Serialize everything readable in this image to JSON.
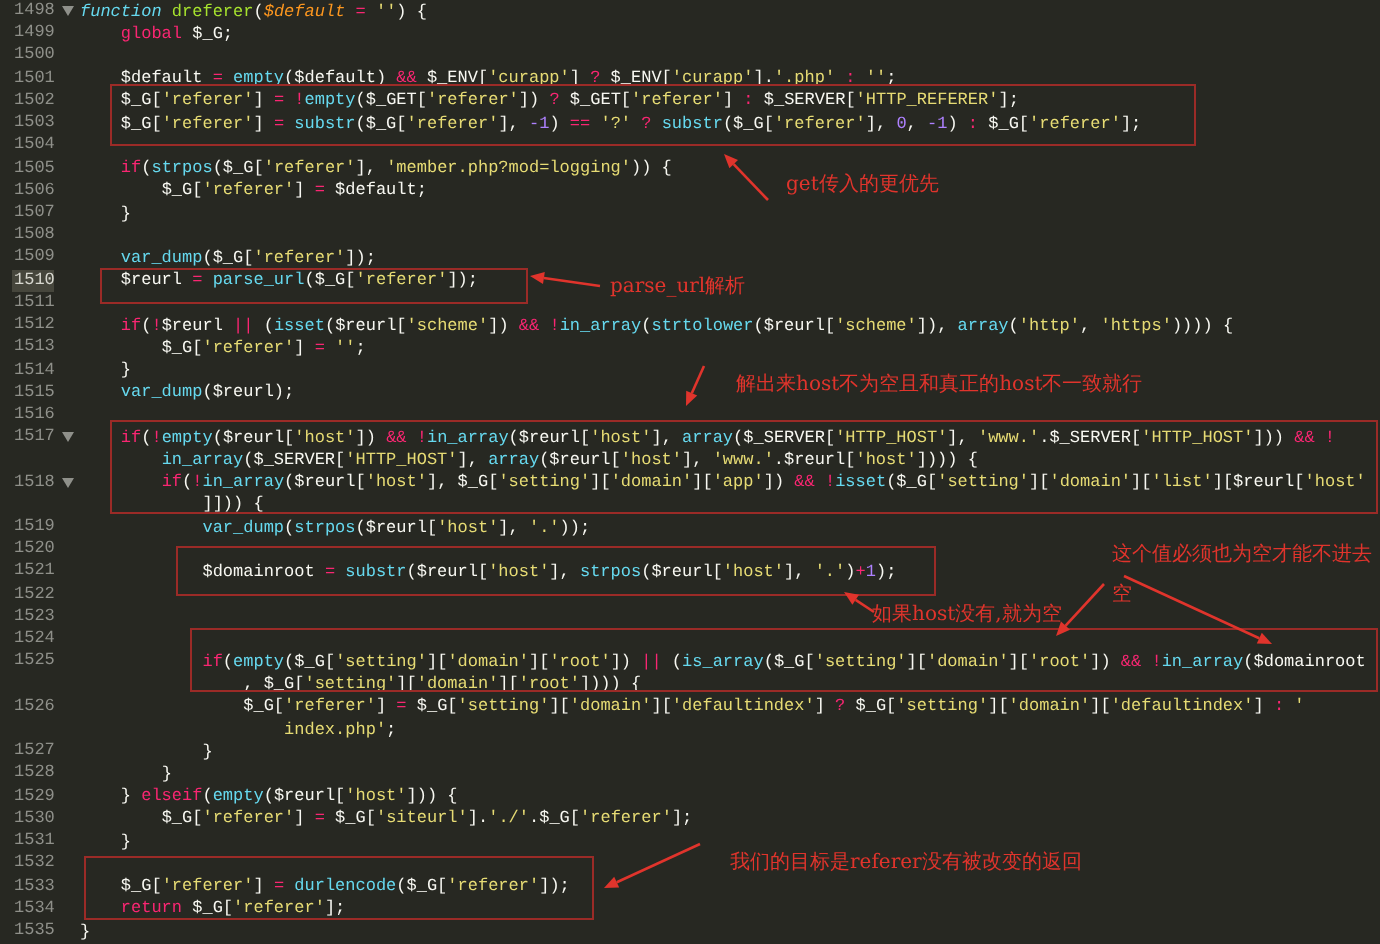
{
  "lines": [
    {
      "number": "1498",
      "fold": true,
      "current": false,
      "rows": [
        {
          "tokens": [
            {
              "kind": "storage",
              "text": "function "
            },
            {
              "kind": "name",
              "text": "dreferer"
            },
            {
              "kind": "plain",
              "text": "("
            },
            {
              "kind": "param",
              "text": "$default "
            },
            {
              "kind": "kw",
              "text": "= "
            },
            {
              "kind": "str",
              "text": "''"
            },
            {
              "kind": "plain",
              "text": ") {"
            }
          ]
        }
      ]
    },
    {
      "number": "1499",
      "fold": false,
      "current": false,
      "rows": [
        {
          "tokens": [
            {
              "kind": "kw",
              "text": "    global"
            },
            {
              "kind": "plain",
              "text": " $_G;"
            }
          ]
        }
      ]
    },
    {
      "number": "1500",
      "fold": false,
      "current": false,
      "rows": [
        {
          "tokens": []
        }
      ]
    },
    {
      "number": "1501",
      "fold": false,
      "current": false,
      "rows": [
        {
          "tokens": [
            {
              "kind": "plain",
              "text": "    $default "
            },
            {
              "kind": "kw",
              "text": "= "
            },
            {
              "kind": "fn",
              "text": "empty"
            },
            {
              "kind": "plain",
              "text": "($default) "
            },
            {
              "kind": "kw",
              "text": "&&"
            },
            {
              "kind": "plain",
              "text": " $_ENV["
            },
            {
              "kind": "str",
              "text": "'curapp'"
            },
            {
              "kind": "plain",
              "text": "] "
            },
            {
              "kind": "kw",
              "text": "?"
            },
            {
              "kind": "plain",
              "text": " $_ENV["
            },
            {
              "kind": "str",
              "text": "'curapp'"
            },
            {
              "kind": "plain",
              "text": "]."
            },
            {
              "kind": "str",
              "text": "'.php' "
            },
            {
              "kind": "kw",
              "text": ": "
            },
            {
              "kind": "str",
              "text": "''"
            },
            {
              "kind": "plain",
              "text": ";"
            }
          ]
        }
      ]
    },
    {
      "number": "1502",
      "fold": false,
      "current": false,
      "rows": [
        {
          "tokens": [
            {
              "kind": "plain",
              "text": "    $_G["
            },
            {
              "kind": "str",
              "text": "'referer'"
            },
            {
              "kind": "plain",
              "text": "] "
            },
            {
              "kind": "kw",
              "text": "= !"
            },
            {
              "kind": "fn",
              "text": "empty"
            },
            {
              "kind": "plain",
              "text": "($_GET["
            },
            {
              "kind": "str",
              "text": "'referer'"
            },
            {
              "kind": "plain",
              "text": "]) "
            },
            {
              "kind": "kw",
              "text": "?"
            },
            {
              "kind": "plain",
              "text": " $_GET["
            },
            {
              "kind": "str",
              "text": "'referer'"
            },
            {
              "kind": "plain",
              "text": "] "
            },
            {
              "kind": "kw",
              "text": ":"
            },
            {
              "kind": "plain",
              "text": " $_SERVER["
            },
            {
              "kind": "str",
              "text": "'HTTP_REFERER'"
            },
            {
              "kind": "plain",
              "text": "];"
            }
          ]
        }
      ]
    },
    {
      "number": "1503",
      "fold": false,
      "current": false,
      "rows": [
        {
          "tokens": [
            {
              "kind": "plain",
              "text": "    $_G["
            },
            {
              "kind": "str",
              "text": "'referer'"
            },
            {
              "kind": "plain",
              "text": "] "
            },
            {
              "kind": "kw",
              "text": "= "
            },
            {
              "kind": "fn",
              "text": "substr"
            },
            {
              "kind": "plain",
              "text": "($_G["
            },
            {
              "kind": "str",
              "text": "'referer'"
            },
            {
              "kind": "plain",
              "text": "], "
            },
            {
              "kind": "num",
              "text": "-1"
            },
            {
              "kind": "plain",
              "text": ") "
            },
            {
              "kind": "kw",
              "text": "== "
            },
            {
              "kind": "str",
              "text": "'?' "
            },
            {
              "kind": "kw",
              "text": "? "
            },
            {
              "kind": "fn",
              "text": "substr"
            },
            {
              "kind": "plain",
              "text": "($_G["
            },
            {
              "kind": "str",
              "text": "'referer'"
            },
            {
              "kind": "plain",
              "text": "], "
            },
            {
              "kind": "num",
              "text": "0"
            },
            {
              "kind": "plain",
              "text": ", "
            },
            {
              "kind": "num",
              "text": "-1"
            },
            {
              "kind": "plain",
              "text": ") "
            },
            {
              "kind": "kw",
              "text": ":"
            },
            {
              "kind": "plain",
              "text": " $_G["
            },
            {
              "kind": "str",
              "text": "'referer'"
            },
            {
              "kind": "plain",
              "text": "];"
            }
          ]
        }
      ]
    },
    {
      "number": "1504",
      "fold": false,
      "current": false,
      "rows": [
        {
          "tokens": []
        }
      ]
    },
    {
      "number": "1505",
      "fold": false,
      "current": false,
      "rows": [
        {
          "tokens": [
            {
              "kind": "kw",
              "text": "    if"
            },
            {
              "kind": "plain",
              "text": "("
            },
            {
              "kind": "fn",
              "text": "strpos"
            },
            {
              "kind": "plain",
              "text": "($_G["
            },
            {
              "kind": "str",
              "text": "'referer'"
            },
            {
              "kind": "plain",
              "text": "], "
            },
            {
              "kind": "str",
              "text": "'member.php?mod=logging'"
            },
            {
              "kind": "plain",
              "text": ")) {"
            }
          ]
        }
      ]
    },
    {
      "number": "1506",
      "fold": false,
      "current": false,
      "rows": [
        {
          "tokens": [
            {
              "kind": "plain",
              "text": "        $_G["
            },
            {
              "kind": "str",
              "text": "'referer'"
            },
            {
              "kind": "plain",
              "text": "] "
            },
            {
              "kind": "kw",
              "text": "="
            },
            {
              "kind": "plain",
              "text": " $default;"
            }
          ]
        }
      ]
    },
    {
      "number": "1507",
      "fold": false,
      "current": false,
      "rows": [
        {
          "tokens": [
            {
              "kind": "plain",
              "text": "    }"
            }
          ]
        }
      ]
    },
    {
      "number": "1508",
      "fold": false,
      "current": false,
      "rows": [
        {
          "tokens": []
        }
      ]
    },
    {
      "number": "1509",
      "fold": false,
      "current": false,
      "rows": [
        {
          "tokens": [
            {
              "kind": "fn",
              "text": "    var_dump"
            },
            {
              "kind": "plain",
              "text": "($_G["
            },
            {
              "kind": "str",
              "text": "'referer'"
            },
            {
              "kind": "plain",
              "text": "]);"
            }
          ]
        }
      ]
    },
    {
      "number": "1510",
      "fold": false,
      "current": true,
      "rows": [
        {
          "tokens": [
            {
              "kind": "plain",
              "text": "    $reurl "
            },
            {
              "kind": "kw",
              "text": "= "
            },
            {
              "kind": "fn",
              "text": "parse_url"
            },
            {
              "kind": "plain",
              "text": "($_G["
            },
            {
              "kind": "str",
              "text": "'referer'"
            },
            {
              "kind": "plain",
              "text": "]);"
            }
          ]
        }
      ]
    },
    {
      "number": "1511",
      "fold": false,
      "current": false,
      "rows": [
        {
          "tokens": []
        }
      ]
    },
    {
      "number": "1512",
      "fold": false,
      "current": false,
      "rows": [
        {
          "tokens": [
            {
              "kind": "kw",
              "text": "    if"
            },
            {
              "kind": "plain",
              "text": "("
            },
            {
              "kind": "kw",
              "text": "!"
            },
            {
              "kind": "plain",
              "text": "$reurl "
            },
            {
              "kind": "kw",
              "text": "||"
            },
            {
              "kind": "plain",
              "text": " ("
            },
            {
              "kind": "fn",
              "text": "isset"
            },
            {
              "kind": "plain",
              "text": "($reurl["
            },
            {
              "kind": "str",
              "text": "'scheme'"
            },
            {
              "kind": "plain",
              "text": "]) "
            },
            {
              "kind": "kw",
              "text": "&& !"
            },
            {
              "kind": "fn",
              "text": "in_array"
            },
            {
              "kind": "plain",
              "text": "("
            },
            {
              "kind": "fn",
              "text": "strtolower"
            },
            {
              "kind": "plain",
              "text": "($reurl["
            },
            {
              "kind": "str",
              "text": "'scheme'"
            },
            {
              "kind": "plain",
              "text": "]), "
            },
            {
              "kind": "fn",
              "text": "array"
            },
            {
              "kind": "plain",
              "text": "("
            },
            {
              "kind": "str",
              "text": "'http'"
            },
            {
              "kind": "plain",
              "text": ", "
            },
            {
              "kind": "str",
              "text": "'https'"
            },
            {
              "kind": "plain",
              "text": ")))) {"
            }
          ]
        }
      ]
    },
    {
      "number": "1513",
      "fold": false,
      "current": false,
      "rows": [
        {
          "tokens": [
            {
              "kind": "plain",
              "text": "        $_G["
            },
            {
              "kind": "str",
              "text": "'referer'"
            },
            {
              "kind": "plain",
              "text": "] "
            },
            {
              "kind": "kw",
              "text": "= "
            },
            {
              "kind": "str",
              "text": "''"
            },
            {
              "kind": "plain",
              "text": ";"
            }
          ]
        }
      ]
    },
    {
      "number": "1514",
      "fold": false,
      "current": false,
      "rows": [
        {
          "tokens": [
            {
              "kind": "plain",
              "text": "    }"
            }
          ]
        }
      ]
    },
    {
      "number": "1515",
      "fold": false,
      "current": false,
      "rows": [
        {
          "tokens": [
            {
              "kind": "fn",
              "text": "    var_dump"
            },
            {
              "kind": "plain",
              "text": "($reurl);"
            }
          ]
        }
      ]
    },
    {
      "number": "1516",
      "fold": false,
      "current": false,
      "rows": [
        {
          "tokens": []
        }
      ]
    },
    {
      "number": "1517",
      "fold": true,
      "current": false,
      "rows": [
        {
          "tokens": [
            {
              "kind": "kw",
              "text": "    if"
            },
            {
              "kind": "plain",
              "text": "("
            },
            {
              "kind": "kw",
              "text": "!"
            },
            {
              "kind": "fn",
              "text": "empty"
            },
            {
              "kind": "plain",
              "text": "($reurl["
            },
            {
              "kind": "str",
              "text": "'host'"
            },
            {
              "kind": "plain",
              "text": "]) "
            },
            {
              "kind": "kw",
              "text": "&& !"
            },
            {
              "kind": "fn",
              "text": "in_array"
            },
            {
              "kind": "plain",
              "text": "($reurl["
            },
            {
              "kind": "str",
              "text": "'host'"
            },
            {
              "kind": "plain",
              "text": "], "
            },
            {
              "kind": "fn",
              "text": "array"
            },
            {
              "kind": "plain",
              "text": "($_SERVER["
            },
            {
              "kind": "str",
              "text": "'HTTP_HOST'"
            },
            {
              "kind": "plain",
              "text": "], "
            },
            {
              "kind": "str",
              "text": "'www.'"
            },
            {
              "kind": "plain",
              "text": ".$_SERVER["
            },
            {
              "kind": "str",
              "text": "'HTTP_HOST'"
            },
            {
              "kind": "plain",
              "text": "])) "
            },
            {
              "kind": "kw",
              "text": "&& !"
            }
          ]
        },
        {
          "tokens": [
            {
              "kind": "fn",
              "text": "        in_array"
            },
            {
              "kind": "plain",
              "text": "($_SERVER["
            },
            {
              "kind": "str",
              "text": "'HTTP_HOST'"
            },
            {
              "kind": "plain",
              "text": "], "
            },
            {
              "kind": "fn",
              "text": "array"
            },
            {
              "kind": "plain",
              "text": "($reurl["
            },
            {
              "kind": "str",
              "text": "'host'"
            },
            {
              "kind": "plain",
              "text": "], "
            },
            {
              "kind": "str",
              "text": "'www.'"
            },
            {
              "kind": "plain",
              "text": ".$reurl["
            },
            {
              "kind": "str",
              "text": "'host'"
            },
            {
              "kind": "plain",
              "text": "]))) {"
            }
          ]
        }
      ]
    },
    {
      "number": "1518",
      "fold": true,
      "current": false,
      "rows": [
        {
          "tokens": [
            {
              "kind": "kw",
              "text": "        if"
            },
            {
              "kind": "plain",
              "text": "("
            },
            {
              "kind": "kw",
              "text": "!"
            },
            {
              "kind": "fn",
              "text": "in_array"
            },
            {
              "kind": "plain",
              "text": "($reurl["
            },
            {
              "kind": "str",
              "text": "'host'"
            },
            {
              "kind": "plain",
              "text": "], $_G["
            },
            {
              "kind": "str",
              "text": "'setting'"
            },
            {
              "kind": "plain",
              "text": "]["
            },
            {
              "kind": "str",
              "text": "'domain'"
            },
            {
              "kind": "plain",
              "text": "]["
            },
            {
              "kind": "str",
              "text": "'app'"
            },
            {
              "kind": "plain",
              "text": "]) "
            },
            {
              "kind": "kw",
              "text": "&& !"
            },
            {
              "kind": "fn",
              "text": "isset"
            },
            {
              "kind": "plain",
              "text": "($_G["
            },
            {
              "kind": "str",
              "text": "'setting'"
            },
            {
              "kind": "plain",
              "text": "]["
            },
            {
              "kind": "str",
              "text": "'domain'"
            },
            {
              "kind": "plain",
              "text": "]["
            },
            {
              "kind": "str",
              "text": "'list'"
            },
            {
              "kind": "plain",
              "text": "][$reurl["
            },
            {
              "kind": "str",
              "text": "'host'"
            }
          ]
        },
        {
          "tokens": [
            {
              "kind": "plain",
              "text": "            ]])) {"
            }
          ]
        }
      ]
    },
    {
      "number": "1519",
      "fold": false,
      "current": false,
      "rows": [
        {
          "tokens": [
            {
              "kind": "fn",
              "text": "            var_dump"
            },
            {
              "kind": "plain",
              "text": "("
            },
            {
              "kind": "fn",
              "text": "strpos"
            },
            {
              "kind": "plain",
              "text": "($reurl["
            },
            {
              "kind": "str",
              "text": "'host'"
            },
            {
              "kind": "plain",
              "text": "], "
            },
            {
              "kind": "str",
              "text": "'.'"
            },
            {
              "kind": "plain",
              "text": "));"
            }
          ]
        }
      ]
    },
    {
      "number": "1520",
      "fold": false,
      "current": false,
      "rows": [
        {
          "tokens": []
        }
      ]
    },
    {
      "number": "1521",
      "fold": false,
      "current": false,
      "rows": [
        {
          "tokens": [
            {
              "kind": "plain",
              "text": "            $domainroot "
            },
            {
              "kind": "kw",
              "text": "= "
            },
            {
              "kind": "fn",
              "text": "substr"
            },
            {
              "kind": "plain",
              "text": "($reurl["
            },
            {
              "kind": "str",
              "text": "'host'"
            },
            {
              "kind": "plain",
              "text": "], "
            },
            {
              "kind": "fn",
              "text": "strpos"
            },
            {
              "kind": "plain",
              "text": "($reurl["
            },
            {
              "kind": "str",
              "text": "'host'"
            },
            {
              "kind": "plain",
              "text": "], "
            },
            {
              "kind": "str",
              "text": "'.'"
            },
            {
              "kind": "plain",
              "text": ")"
            },
            {
              "kind": "kw",
              "text": "+"
            },
            {
              "kind": "num",
              "text": "1"
            },
            {
              "kind": "plain",
              "text": ");"
            }
          ]
        }
      ]
    },
    {
      "number": "1522",
      "fold": false,
      "current": false,
      "rows": [
        {
          "tokens": []
        }
      ]
    },
    {
      "number": "1523",
      "fold": false,
      "current": false,
      "rows": [
        {
          "tokens": []
        }
      ]
    },
    {
      "number": "1524",
      "fold": false,
      "current": false,
      "rows": [
        {
          "tokens": []
        }
      ]
    },
    {
      "number": "1525",
      "fold": false,
      "current": false,
      "rows": [
        {
          "tokens": [
            {
              "kind": "kw",
              "text": "            if"
            },
            {
              "kind": "plain",
              "text": "("
            },
            {
              "kind": "fn",
              "text": "empty"
            },
            {
              "kind": "plain",
              "text": "($_G["
            },
            {
              "kind": "str",
              "text": "'setting'"
            },
            {
              "kind": "plain",
              "text": "]["
            },
            {
              "kind": "str",
              "text": "'domain'"
            },
            {
              "kind": "plain",
              "text": "]["
            },
            {
              "kind": "str",
              "text": "'root'"
            },
            {
              "kind": "plain",
              "text": "]) "
            },
            {
              "kind": "kw",
              "text": "||"
            },
            {
              "kind": "plain",
              "text": " ("
            },
            {
              "kind": "fn",
              "text": "is_array"
            },
            {
              "kind": "plain",
              "text": "($_G["
            },
            {
              "kind": "str",
              "text": "'setting'"
            },
            {
              "kind": "plain",
              "text": "]["
            },
            {
              "kind": "str",
              "text": "'domain'"
            },
            {
              "kind": "plain",
              "text": "]["
            },
            {
              "kind": "str",
              "text": "'root'"
            },
            {
              "kind": "plain",
              "text": "]) "
            },
            {
              "kind": "kw",
              "text": "&& !"
            },
            {
              "kind": "fn",
              "text": "in_array"
            },
            {
              "kind": "plain",
              "text": "($domainroot"
            }
          ]
        },
        {
          "tokens": [
            {
              "kind": "plain",
              "text": "                , $_G["
            },
            {
              "kind": "str",
              "text": "'setting'"
            },
            {
              "kind": "plain",
              "text": "]["
            },
            {
              "kind": "str",
              "text": "'domain'"
            },
            {
              "kind": "plain",
              "text": "]["
            },
            {
              "kind": "str",
              "text": "'root'"
            },
            {
              "kind": "plain",
              "text": "]))) {"
            }
          ]
        }
      ]
    },
    {
      "number": "1526",
      "fold": false,
      "current": false,
      "rows": [
        {
          "tokens": [
            {
              "kind": "plain",
              "text": "                $_G["
            },
            {
              "kind": "str",
              "text": "'referer'"
            },
            {
              "kind": "plain",
              "text": "] "
            },
            {
              "kind": "kw",
              "text": "="
            },
            {
              "kind": "plain",
              "text": " $_G["
            },
            {
              "kind": "str",
              "text": "'setting'"
            },
            {
              "kind": "plain",
              "text": "]["
            },
            {
              "kind": "str",
              "text": "'domain'"
            },
            {
              "kind": "plain",
              "text": "]["
            },
            {
              "kind": "str",
              "text": "'defaultindex'"
            },
            {
              "kind": "plain",
              "text": "] "
            },
            {
              "kind": "kw",
              "text": "?"
            },
            {
              "kind": "plain",
              "text": " $_G["
            },
            {
              "kind": "str",
              "text": "'setting'"
            },
            {
              "kind": "plain",
              "text": "]["
            },
            {
              "kind": "str",
              "text": "'domain'"
            },
            {
              "kind": "plain",
              "text": "]["
            },
            {
              "kind": "str",
              "text": "'defaultindex'"
            },
            {
              "kind": "plain",
              "text": "] "
            },
            {
              "kind": "kw",
              "text": ": "
            },
            {
              "kind": "str",
              "text": "'"
            }
          ]
        },
        {
          "tokens": [
            {
              "kind": "str",
              "text": "                    index.php'"
            },
            {
              "kind": "plain",
              "text": ";"
            }
          ]
        }
      ]
    },
    {
      "number": "1527",
      "fold": false,
      "current": false,
      "rows": [
        {
          "tokens": [
            {
              "kind": "plain",
              "text": "            }"
            }
          ]
        }
      ]
    },
    {
      "number": "1528",
      "fold": false,
      "current": false,
      "rows": [
        {
          "tokens": [
            {
              "kind": "plain",
              "text": "        }"
            }
          ]
        }
      ]
    },
    {
      "number": "1529",
      "fold": false,
      "current": false,
      "rows": [
        {
          "tokens": [
            {
              "kind": "plain",
              "text": "    } "
            },
            {
              "kind": "kw",
              "text": "elseif"
            },
            {
              "kind": "plain",
              "text": "("
            },
            {
              "kind": "fn",
              "text": "empty"
            },
            {
              "kind": "plain",
              "text": "($reurl["
            },
            {
              "kind": "str",
              "text": "'host'"
            },
            {
              "kind": "plain",
              "text": "])) {"
            }
          ]
        }
      ]
    },
    {
      "number": "1530",
      "fold": false,
      "current": false,
      "rows": [
        {
          "tokens": [
            {
              "kind": "plain",
              "text": "        $_G["
            },
            {
              "kind": "str",
              "text": "'referer'"
            },
            {
              "kind": "plain",
              "text": "] "
            },
            {
              "kind": "kw",
              "text": "="
            },
            {
              "kind": "plain",
              "text": " $_G["
            },
            {
              "kind": "str",
              "text": "'siteurl'"
            },
            {
              "kind": "plain",
              "text": "]."
            },
            {
              "kind": "str",
              "text": "'./'"
            },
            {
              "kind": "plain",
              "text": ".$_G["
            },
            {
              "kind": "str",
              "text": "'referer'"
            },
            {
              "kind": "plain",
              "text": "];"
            }
          ]
        }
      ]
    },
    {
      "number": "1531",
      "fold": false,
      "current": false,
      "rows": [
        {
          "tokens": [
            {
              "kind": "plain",
              "text": "    }"
            }
          ]
        }
      ]
    },
    {
      "number": "1532",
      "fold": false,
      "current": false,
      "rows": [
        {
          "tokens": []
        }
      ]
    },
    {
      "number": "1533",
      "fold": false,
      "current": false,
      "rows": [
        {
          "tokens": [
            {
              "kind": "plain",
              "text": "    $_G["
            },
            {
              "kind": "str",
              "text": "'referer'"
            },
            {
              "kind": "plain",
              "text": "] "
            },
            {
              "kind": "kw",
              "text": "= "
            },
            {
              "kind": "fn",
              "text": "durlencode"
            },
            {
              "kind": "plain",
              "text": "($_G["
            },
            {
              "kind": "str",
              "text": "'referer'"
            },
            {
              "kind": "plain",
              "text": "]);"
            }
          ]
        }
      ]
    },
    {
      "number": "1534",
      "fold": false,
      "current": false,
      "rows": [
        {
          "tokens": [
            {
              "kind": "kw",
              "text": "    return"
            },
            {
              "kind": "plain",
              "text": " $_G["
            },
            {
              "kind": "str",
              "text": "'referer'"
            },
            {
              "kind": "plain",
              "text": "];"
            }
          ]
        }
      ]
    },
    {
      "number": "1535",
      "fold": false,
      "current": false,
      "rows": [
        {
          "tokens": [
            {
              "kind": "plain",
              "text": "}"
            }
          ]
        }
      ]
    }
  ],
  "annotations": [
    {
      "text": "get传入的更优先"
    },
    {
      "text": "parse_url解析"
    },
    {
      "text": "解出来host不为空且和真正的host不一致就行"
    },
    {
      "text": "这个值必须也为空才能不进去"
    },
    {
      "text": "空"
    },
    {
      "text": "如果host没有,就为空"
    },
    {
      "text": "我们的目标是referer没有被改变的返回"
    }
  ]
}
